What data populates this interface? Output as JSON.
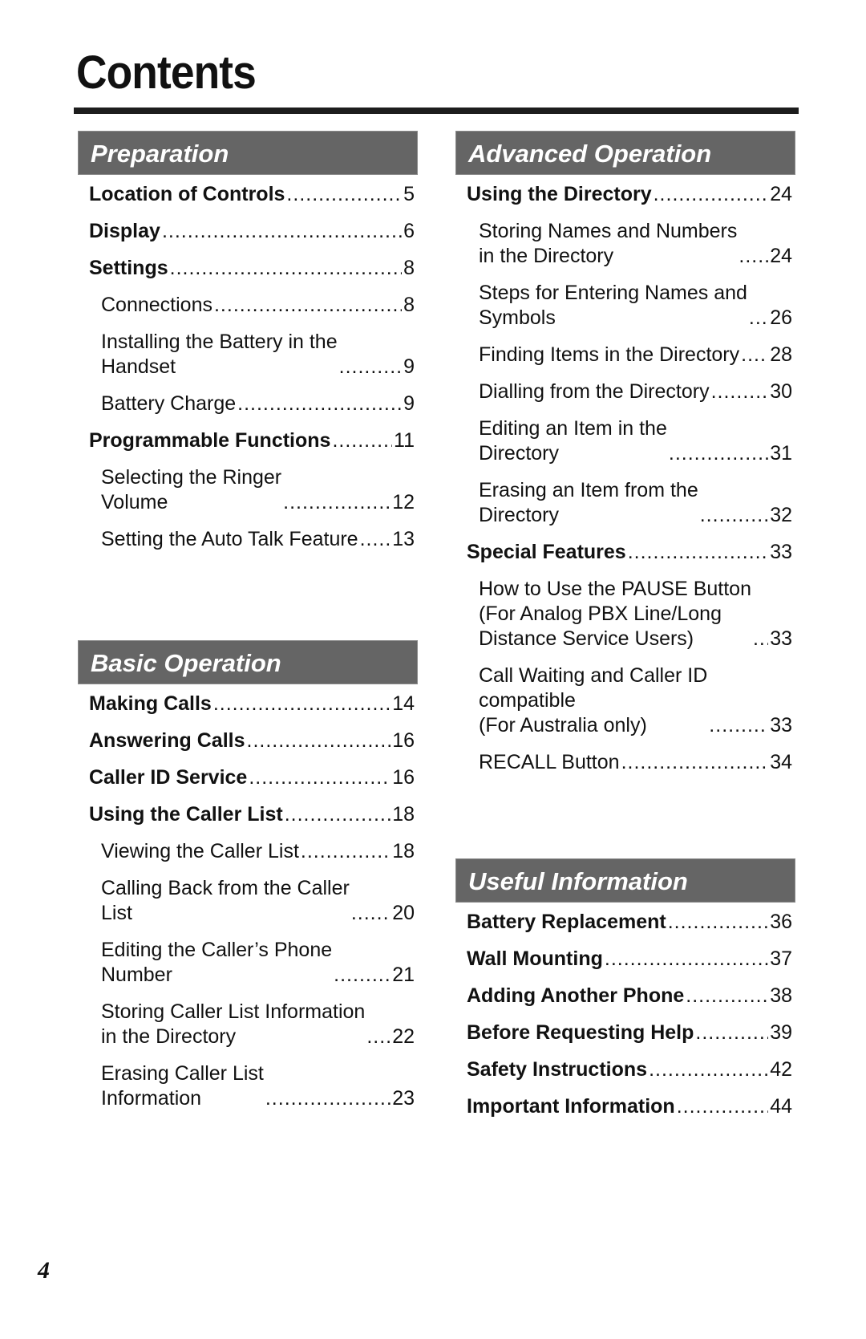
{
  "page": {
    "title": "Contents",
    "page_number": "4"
  },
  "sections": {
    "preparation": {
      "heading": "Preparation",
      "entries": [
        {
          "level": "main",
          "label": "Location of Controls",
          "page": "5"
        },
        {
          "level": "main",
          "label": "Display",
          "page": "6"
        },
        {
          "level": "main",
          "label": "Settings",
          "page": "8"
        },
        {
          "level": "sub",
          "label": "Connections",
          "page": "8"
        },
        {
          "level": "sub",
          "label": "Installing the Battery in the\nHandset",
          "page": "9"
        },
        {
          "level": "sub",
          "label": "Battery Charge",
          "page": "9"
        },
        {
          "level": "main",
          "label": "Programmable Functions",
          "page": "11"
        },
        {
          "level": "sub",
          "label": "Selecting the Ringer\nVolume",
          "page": "12"
        },
        {
          "level": "sub",
          "label": "Setting the Auto Talk Feature",
          "page": "13"
        }
      ]
    },
    "basic": {
      "heading": "Basic Operation",
      "entries": [
        {
          "level": "main",
          "label": "Making Calls",
          "page": "14"
        },
        {
          "level": "main",
          "label": "Answering Calls",
          "page": "16"
        },
        {
          "level": "main",
          "label": "Caller ID Service",
          "page": "16"
        },
        {
          "level": "main",
          "label": "Using the Caller List",
          "page": "18"
        },
        {
          "level": "sub",
          "label": "Viewing the Caller List",
          "page": "18"
        },
        {
          "level": "sub",
          "label": "Calling Back from the Caller\nList",
          "page": "20"
        },
        {
          "level": "sub",
          "label": "Editing the Caller’s Phone\nNumber",
          "page": "21"
        },
        {
          "level": "sub",
          "label": "Storing Caller List Information\nin the Directory",
          "page": "22"
        },
        {
          "level": "sub",
          "label": "Erasing Caller List\nInformation",
          "page": "23"
        }
      ]
    },
    "advanced": {
      "heading": "Advanced Operation",
      "entries": [
        {
          "level": "main",
          "label": "Using the Directory",
          "page": "24"
        },
        {
          "level": "sub",
          "label": "Storing Names and Numbers\nin the Directory",
          "page": "24"
        },
        {
          "level": "sub",
          "label": "Steps for Entering Names and\nSymbols",
          "page": "26"
        },
        {
          "level": "sub",
          "label": "Finding Items in the Directory",
          "page": "28"
        },
        {
          "level": "sub",
          "label": "Dialling from the Directory",
          "page": "30"
        },
        {
          "level": "sub",
          "label": "Editing an Item in the\nDirectory",
          "page": "31"
        },
        {
          "level": "sub",
          "label": "Erasing an Item from the\nDirectory",
          "page": "32"
        },
        {
          "level": "main",
          "label": "Special Features",
          "page": "33"
        },
        {
          "level": "sub",
          "label": "How to Use the PAUSE Button\n(For Analog PBX Line/Long\nDistance Service Users)",
          "page": "33"
        },
        {
          "level": "sub",
          "label": "Call Waiting and Caller ID\ncompatible\n(For Australia only)",
          "page": "33"
        },
        {
          "level": "sub",
          "label": "RECALL Button",
          "page": "34"
        }
      ]
    },
    "useful": {
      "heading": "Useful Information",
      "entries": [
        {
          "level": "main",
          "label": "Battery Replacement",
          "page": "36"
        },
        {
          "level": "main",
          "label": "Wall Mounting",
          "page": "37"
        },
        {
          "level": "main",
          "label": "Adding Another Phone",
          "page": "38"
        },
        {
          "level": "main",
          "label": "Before Requesting Help",
          "page": "39"
        },
        {
          "level": "main",
          "label": "Safety Instructions",
          "page": "42"
        },
        {
          "level": "main",
          "label": "Important Information",
          "page": "44"
        }
      ]
    }
  }
}
